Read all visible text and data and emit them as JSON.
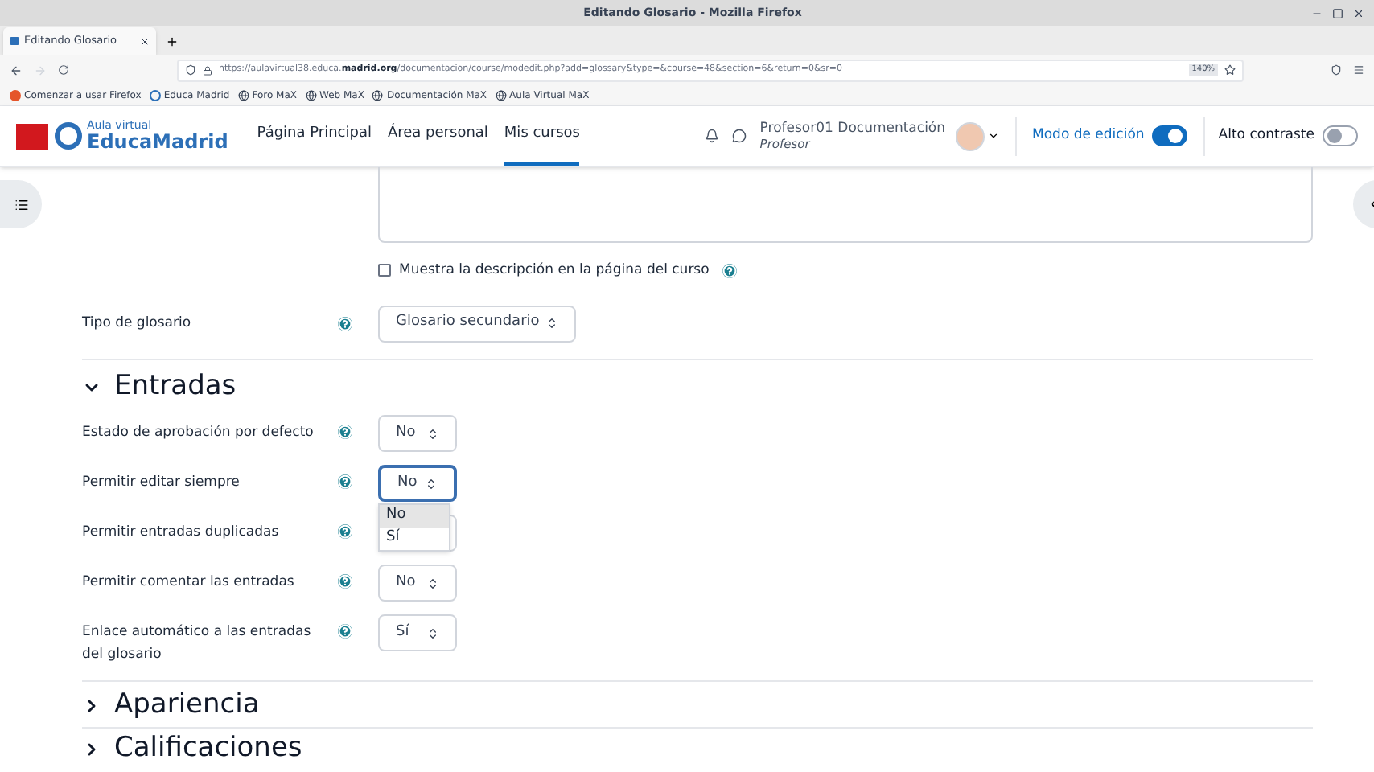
{
  "window": {
    "title": "Editando Glosario - Mozilla Firefox"
  },
  "tabs": [
    {
      "label": "Editando Glosario",
      "selected": true
    }
  ],
  "address": {
    "prefix": "https://aulavirtual38.educa.",
    "host": "madrid.org",
    "path": "/documentacion/course/modedit.php?add=glossary&type=&course=48&section=6&return=0&sr=0"
  },
  "zoom": "140%",
  "bookmarks": [
    {
      "label": "Comenzar a usar Firefox",
      "kind": "firefox"
    },
    {
      "label": "Educa Madrid",
      "kind": "educa"
    },
    {
      "label": "Foro MaX",
      "kind": "globe"
    },
    {
      "label": "Web MaX",
      "kind": "globe"
    },
    {
      "label": "Documentación MaX",
      "kind": "globe"
    },
    {
      "label": "Aula Virtual MaX",
      "kind": "globe"
    }
  ],
  "site": {
    "logo_small": "Aula virtual",
    "logo_big": "EducaMadrid",
    "nav": [
      {
        "label": "Página Principal",
        "selected": false
      },
      {
        "label": "Área personal",
        "selected": false
      },
      {
        "label": "Mis cursos",
        "selected": true
      }
    ],
    "user_name": "Profesor01 Documentación",
    "user_role": "Profesor",
    "edit_mode": {
      "label": "Modo de edición",
      "on": true
    },
    "contrast": {
      "label": "Alto contraste",
      "on": false
    }
  },
  "show_description": {
    "label": "Muestra la descripción en la página del curso",
    "checked": false
  },
  "glossary_type": {
    "label": "Tipo de glosario",
    "value": "Glosario secundario"
  },
  "sections": [
    {
      "title": "Entradas",
      "expanded": true
    },
    {
      "title": "Apariencia",
      "expanded": false
    },
    {
      "title": "Calificaciones",
      "expanded": false
    }
  ],
  "entries": [
    {
      "label": "Estado de aprobación por defecto",
      "value": "No",
      "focused": false
    },
    {
      "label": "Permitir editar siempre",
      "value": "No",
      "focused": true
    },
    {
      "label": "Permitir entradas duplicadas",
      "focused": false
    },
    {
      "label": "Permitir comentar las entradas",
      "value": "No",
      "focused": false
    },
    {
      "label": "Enlace automático a las entradas del glosario",
      "value": "Sí",
      "focused": false
    }
  ],
  "dropdown": [
    {
      "label": "No",
      "selected": true
    },
    {
      "label": "Sí",
      "selected": false
    }
  ]
}
